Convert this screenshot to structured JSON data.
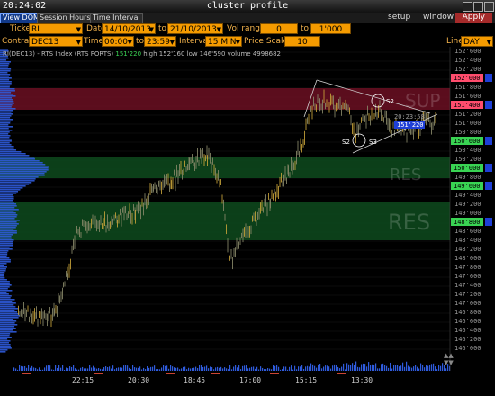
{
  "window": {
    "clock": "20:24:02",
    "title": "cluster profile"
  },
  "menu": {
    "tabs": [
      "View DOM",
      "Session Hours",
      "Time Interval"
    ],
    "active_tab": "View DOM",
    "right_items": [
      "setup",
      "window"
    ],
    "apply_label": "Apply"
  },
  "controls": {
    "ticker_label": "Ticker",
    "ticker_value": "RI",
    "date_label": "Date",
    "date_from": "14/10/2013",
    "to_label": "to",
    "date_to": "21/10/2013",
    "vol_range_label": "Vol range",
    "vol_from": "0",
    "vol_to_label": "to",
    "vol_to": "1'000",
    "contract_label": "Contract",
    "contract_value": "DEC13",
    "time_label": "Time",
    "time_from": "00:00",
    "time_to_label": "to",
    "time_to": "23:59",
    "interval_label": "Interval",
    "interval_value": "15 MIN",
    "price_scale_label": "Price Scale",
    "price_scale_value": "10",
    "line_label": "Line",
    "line_value": "DAY"
  },
  "info": {
    "symbol_text": "RI(DEC13) - RTS Index (RTS FORTS)",
    "last_price": "151'220",
    "stats": "high 152'160   low 146'590   volume 4998682"
  },
  "price_axis": {
    "labels": [
      "152'600",
      "152'400",
      "152'200",
      "152'000",
      "151'800",
      "151'600",
      "151'400",
      "151'200",
      "151'000",
      "150'800",
      "150'600",
      "150'400",
      "150'200",
      "150'000",
      "149'800",
      "149'600",
      "149'400",
      "149'200",
      "149'000",
      "148'800",
      "148'600",
      "148'400",
      "148'200",
      "148'000",
      "147'800",
      "147'600",
      "147'400",
      "147'200",
      "147'000",
      "146'800",
      "146'600",
      "146'400",
      "146'200",
      "146'000"
    ],
    "boxed": [
      {
        "label": "152'000",
        "color": "#ff4d6d"
      },
      {
        "label": "151'400",
        "color": "#ff4d6d"
      },
      {
        "label": "150'600",
        "color": "#39d353"
      },
      {
        "label": "150'000",
        "color": "#39d353"
      },
      {
        "label": "149'600",
        "color": "#39d353"
      },
      {
        "label": "148'800",
        "color": "#39d353"
      }
    ],
    "last_label": "151'220",
    "last_time": "20:23:58"
  },
  "time_axis": {
    "labels": [
      "22:15",
      "20:30",
      "18:45",
      "17:00",
      "15:15",
      "13:30"
    ]
  },
  "zones": {
    "sup_label": "SUP",
    "res_small_label": "RES",
    "res_large_label": "RES"
  },
  "annotations": [
    "S2",
    "S2",
    "S3"
  ],
  "colors": {
    "ticker_field": "#f59b00",
    "label_text": "#f2b24b",
    "sup_zone": "#7a0f25",
    "res_zone": "#0d4d1c",
    "last_price_box": "#1e3fd6",
    "profile": "#3b6fff"
  }
}
